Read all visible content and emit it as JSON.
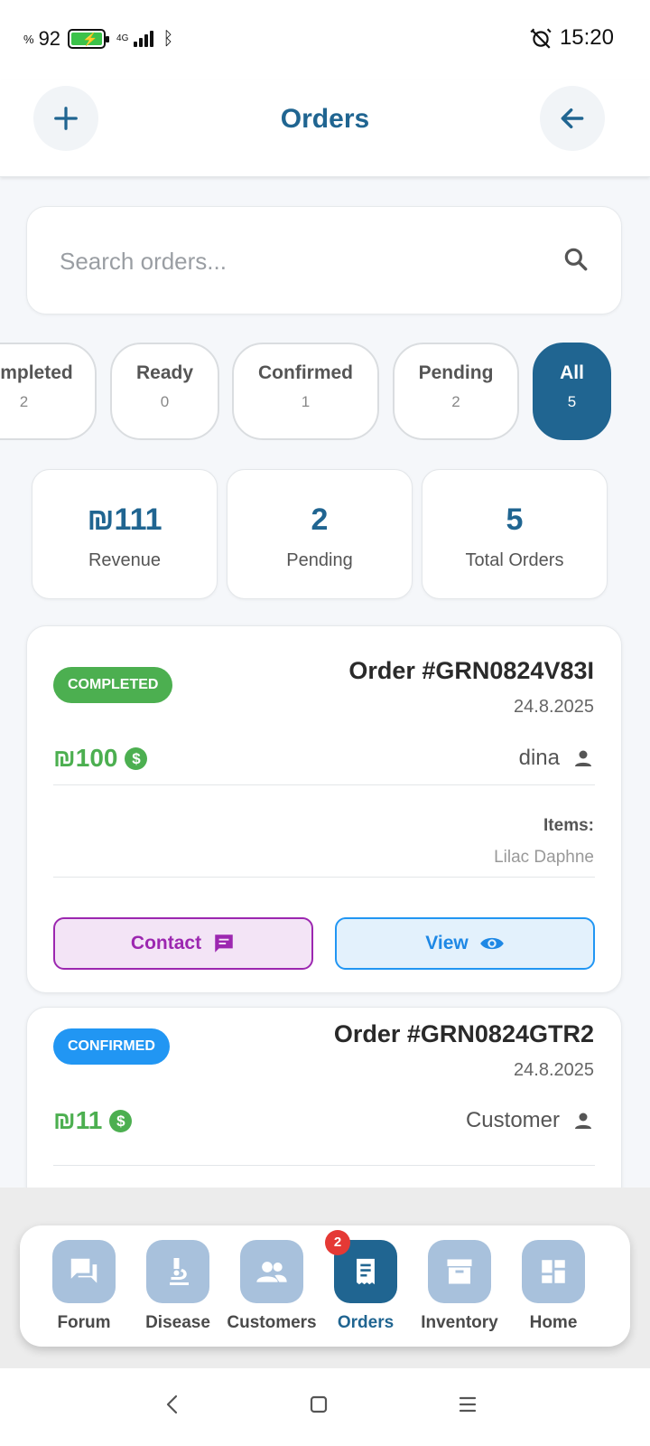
{
  "status_bar": {
    "battery_percent": "92",
    "percent_sign": "%",
    "network": "4G",
    "time": "15:20"
  },
  "header": {
    "title": "Orders",
    "add_icon": "plus-icon",
    "back_icon": "arrow-back-icon"
  },
  "search": {
    "placeholder": "Search orders...",
    "icon": "search-icon"
  },
  "filters": [
    {
      "label": "Completed",
      "count": "2",
      "active": false
    },
    {
      "label": "Ready",
      "count": "0",
      "active": false
    },
    {
      "label": "Confirmed",
      "count": "1",
      "active": false
    },
    {
      "label": "Pending",
      "count": "2",
      "active": false
    },
    {
      "label": "All",
      "count": "5",
      "active": true
    }
  ],
  "stats": [
    {
      "value": "₪111",
      "label": "Revenue"
    },
    {
      "value": "2",
      "label": "Pending"
    },
    {
      "value": "5",
      "label": "Total Orders"
    }
  ],
  "orders": [
    {
      "status": "COMPLETED",
      "title": "Order #GRN0824V83I",
      "date": "24.8.2025",
      "amount": "₪100",
      "customer": "dina",
      "items_label": "Items:",
      "items": "Lilac Daphne",
      "contact_label": "Contact",
      "view_label": "View"
    },
    {
      "status": "CONFIRMED",
      "title": "Order #GRN0824GTR2",
      "date": "24.8.2025",
      "amount": "₪11",
      "customer": "Customer"
    }
  ],
  "bottom_nav": {
    "items": [
      {
        "label": "Forum",
        "icon": "forum-icon"
      },
      {
        "label": "Disease",
        "icon": "microscope-icon"
      },
      {
        "label": "Customers",
        "icon": "people-icon"
      },
      {
        "label": "Orders",
        "icon": "receipt-icon",
        "badge": "2",
        "active": true
      },
      {
        "label": "Inventory",
        "icon": "archive-box-icon"
      },
      {
        "label": "Home",
        "icon": "dashboard-icon"
      }
    ]
  },
  "colors": {
    "primary": "#206591",
    "completed": "#4caf50",
    "confirmed": "#2196f3",
    "contact": "#9c27b0",
    "badge_red": "#e53935",
    "nav_icon_inactive": "#a8c1dc"
  }
}
